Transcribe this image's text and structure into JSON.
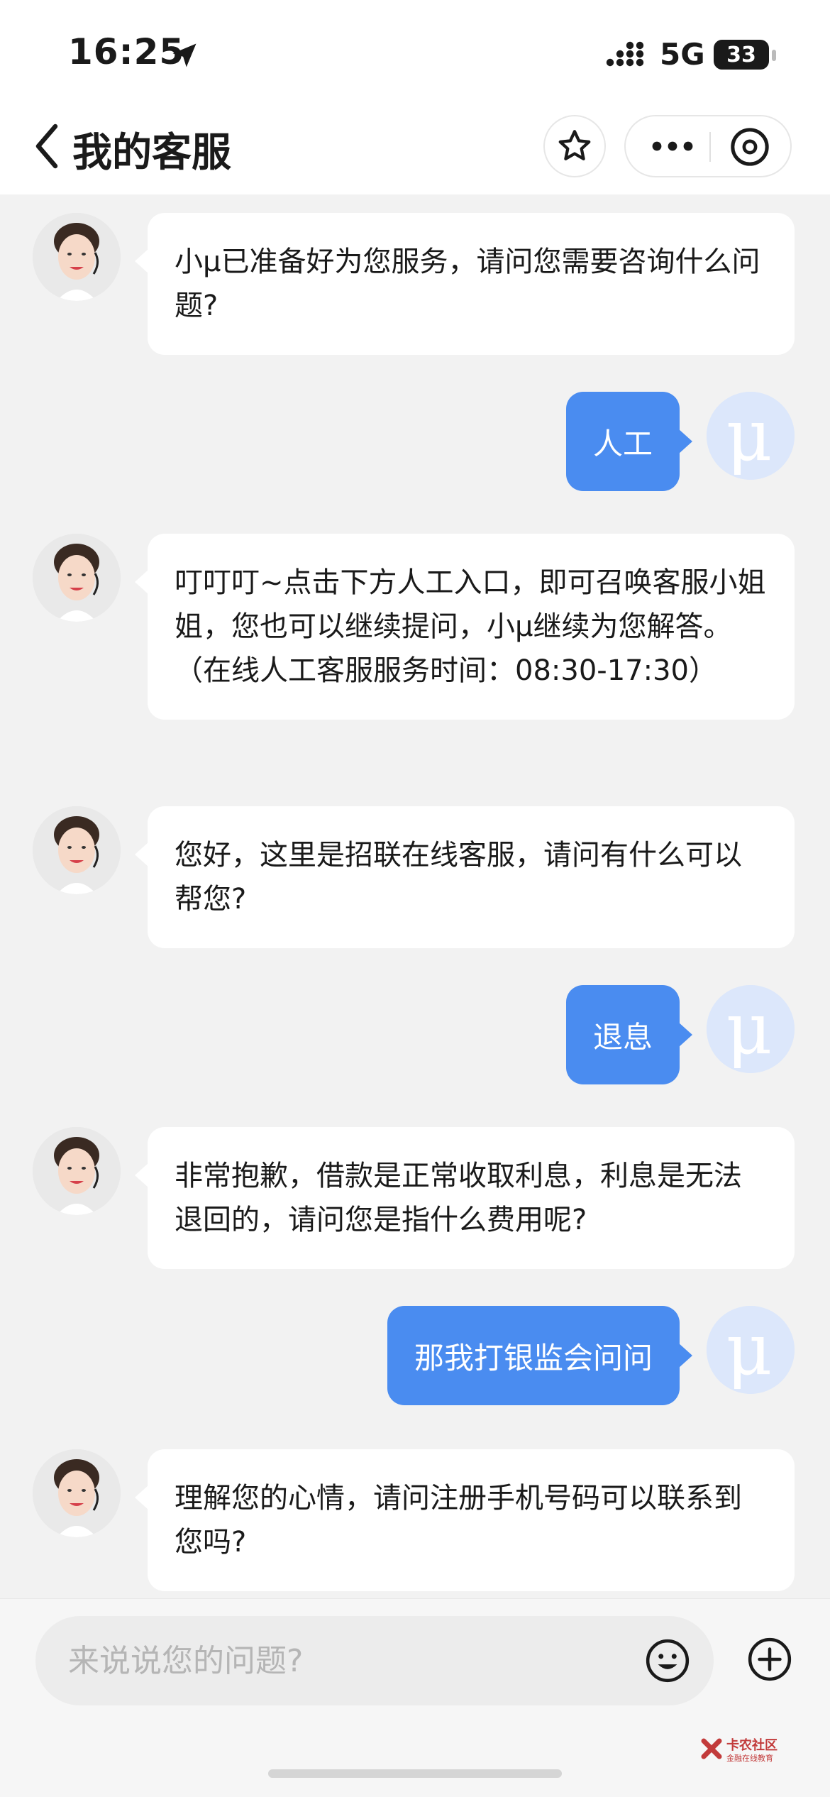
{
  "status_bar": {
    "time": "16:25",
    "network": "5G",
    "battery": "33"
  },
  "nav": {
    "title": "我的客服"
  },
  "messages": [
    {
      "from": "agent",
      "text": "小μ已准备好为您服务，请问您需要咨询什么问题?"
    },
    {
      "from": "user",
      "text": "人工"
    },
    {
      "from": "agent",
      "text": "叮叮叮~点击下方人工入口，即可召唤客服小姐姐，您也可以继续提问，小μ继续为您解答。（在线人工客服服务时间：08:30-17:30）"
    },
    {
      "from": "agent",
      "text": "您好，这里是招联在线客服，请问有什么可以帮您?"
    },
    {
      "from": "user",
      "text": "退息"
    },
    {
      "from": "agent",
      "text": "非常抱歉，借款是正常收取利息，利息是无法退回的，请问您是指什么费用呢?"
    },
    {
      "from": "user",
      "text": "那我打银监会问问"
    },
    {
      "from": "agent",
      "text": "理解您的心情，请问注册手机号码可以联系到您吗?"
    }
  ],
  "user_avatar_letter": "μ",
  "input": {
    "placeholder": "来说说您的问题?",
    "value": ""
  },
  "watermark": {
    "title": "卡农社区",
    "subtitle": "金融在线教育"
  },
  "colors": {
    "user_bubble": "#4a8cf0",
    "agent_bubble": "#ffffff",
    "background": "#f2f2f2"
  },
  "icons": [
    "location-arrow-icon",
    "signal-icon",
    "back-chevron-icon",
    "star-icon",
    "more-dots-icon",
    "close-circle-icon",
    "emoji-icon",
    "plus-circle-icon"
  ]
}
